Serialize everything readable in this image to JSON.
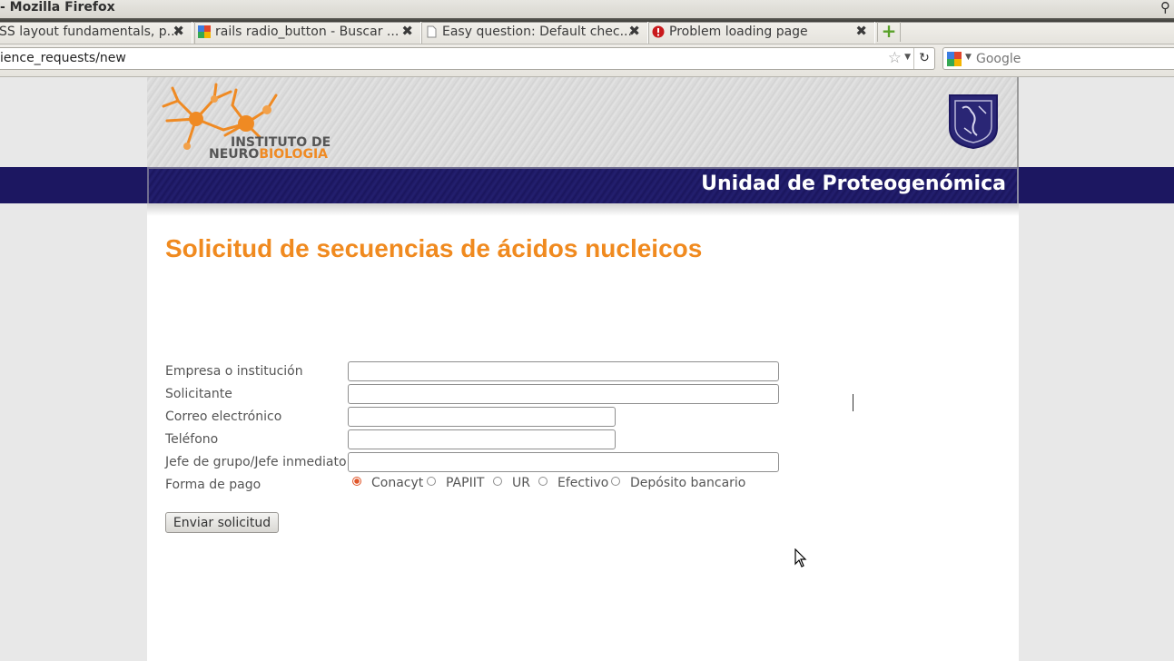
{
  "window": {
    "title": "- Mozilla Firefox"
  },
  "tabs": [
    {
      "label": "SS layout fundamentals, p...",
      "favicon": "none"
    },
    {
      "label": "rails radio_button - Buscar ...",
      "favicon": "google-icon"
    },
    {
      "label": "Easy question: Default chec...",
      "favicon": "page-icon"
    },
    {
      "label": "Problem loading page",
      "favicon": "error-icon"
    }
  ],
  "newtab_label": "+",
  "navbar": {
    "url": "ience_requests/new",
    "search_placeholder": "Google"
  },
  "header": {
    "logo_line1": "INSTITUTO DE",
    "logo_line2a": "NEURO",
    "logo_line2b": "BIOLOGIA",
    "unit_title": "Unidad de Proteogenómica"
  },
  "form": {
    "title": "Solicitud de secuencias de ácidos nucleicos",
    "fields": [
      {
        "label": "Empresa o institución",
        "value": ""
      },
      {
        "label": "Solicitante",
        "value": ""
      },
      {
        "label": "Correo electrónico",
        "value": ""
      },
      {
        "label": "Teléfono",
        "value": ""
      },
      {
        "label": "Jefe de grupo/Jefe inmediato",
        "value": ""
      }
    ],
    "payment_label": "Forma de pago",
    "payment_options": [
      "Conacyt",
      "PAPIIT",
      "UR",
      "Efectivo",
      "Depósito bancario"
    ],
    "payment_selected": "Conacyt",
    "submit_label": "Enviar solicitud"
  },
  "colors": {
    "title_orange": "#f08a1f",
    "banner_navy": "#1c1761",
    "radio_selected": "#e0562a"
  }
}
